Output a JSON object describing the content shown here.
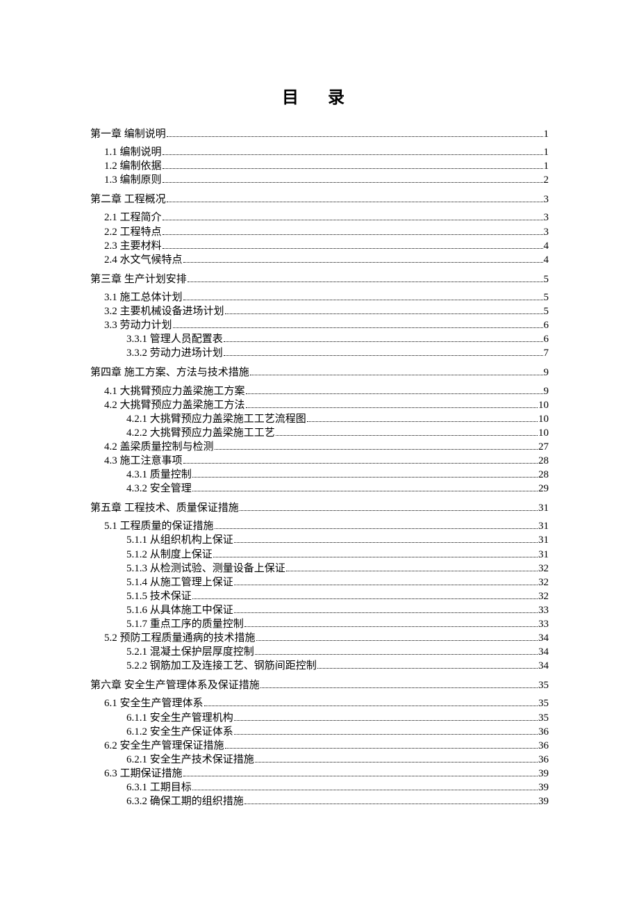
{
  "title": "目 录",
  "toc": [
    {
      "level": 1,
      "label": "第一章 编制说明",
      "page": "1"
    },
    {
      "level": 2,
      "label": "1.1 编制说明",
      "page": "1"
    },
    {
      "level": 2,
      "label": "1.2 编制依据",
      "page": "1"
    },
    {
      "level": 2,
      "label": "1.3 编制原则",
      "page": "2"
    },
    {
      "level": 1,
      "label": "第二章 工程概况",
      "page": "3"
    },
    {
      "level": 2,
      "label": "2.1 工程简介",
      "page": "3"
    },
    {
      "level": 2,
      "label": "2.2 工程特点",
      "page": "3"
    },
    {
      "level": 2,
      "label": "2.3 主要材料",
      "page": "4"
    },
    {
      "level": 2,
      "label": "2.4 水文气候特点",
      "page": "4"
    },
    {
      "level": 1,
      "label": "第三章   生产计划安排",
      "page": "5"
    },
    {
      "level": 2,
      "label": "3.1 施工总体计划",
      "page": "5"
    },
    {
      "level": 2,
      "label": "3.2 主要机械设备进场计划",
      "page": "5"
    },
    {
      "level": 2,
      "label": "3.3 劳动力计划",
      "page": "6"
    },
    {
      "level": 3,
      "label": "3.3.1 管理人员配置表",
      "page": "6"
    },
    {
      "level": 3,
      "label": "3.3.2 劳动力进场计划",
      "page": "7"
    },
    {
      "level": 1,
      "label": "第四章 施工方案、方法与技术措施",
      "page": "9"
    },
    {
      "level": 2,
      "label": "4.1 大挑臂预应力盖梁施工方案",
      "page": "9"
    },
    {
      "level": 2,
      "label": "4.2 大挑臂预应力盖梁施工方法",
      "page": "10"
    },
    {
      "level": 3,
      "label": "4.2.1 大挑臂预应力盖梁施工工艺流程图",
      "page": "10"
    },
    {
      "level": 3,
      "label": "4.2.2 大挑臂预应力盖梁施工工艺",
      "page": "10"
    },
    {
      "level": 2,
      "label": "4.2 盖梁质量控制与检测",
      "page": "27"
    },
    {
      "level": 2,
      "label": "4.3 施工注意事项",
      "page": "28"
    },
    {
      "level": 3,
      "label": "4.3.1 质量控制",
      "page": "28"
    },
    {
      "level": 3,
      "label": "4.3.2 安全管理",
      "page": "29"
    },
    {
      "level": 1,
      "label": "第五章 工程技术、质量保证措施",
      "page": "31"
    },
    {
      "level": 2,
      "label": "5.1 工程质量的保证措施",
      "page": "31"
    },
    {
      "level": 3,
      "label": "5.1.1 从组织机构上保证",
      "page": "31"
    },
    {
      "level": 3,
      "label": "5.1.2 从制度上保证",
      "page": "31"
    },
    {
      "level": 3,
      "label": "5.1.3 从检测试验、测量设备上保证",
      "page": "32"
    },
    {
      "level": 3,
      "label": "5.1.4 从施工管理上保证",
      "page": "32"
    },
    {
      "level": 3,
      "label": "5.1.5 技术保证",
      "page": "32"
    },
    {
      "level": 3,
      "label": "5.1.6 从具体施工中保证",
      "page": "33"
    },
    {
      "level": 3,
      "label": "5.1.7 重点工序的质量控制",
      "page": "33"
    },
    {
      "level": 2,
      "label": "5.2 预防工程质量通病的技术措施",
      "page": "34"
    },
    {
      "level": 3,
      "label": "5.2.1 混凝土保护层厚度控制",
      "page": "34"
    },
    {
      "level": 3,
      "label": "5.2.2 钢筋加工及连接工艺、钢筋间距控制",
      "page": "34"
    },
    {
      "level": 1,
      "label": "第六章 安全生产管理体系及保证措施",
      "page": "35"
    },
    {
      "level": 2,
      "label": "6.1 安全生产管理体系",
      "page": "35"
    },
    {
      "level": 3,
      "label": "6.1.1 安全生产管理机构",
      "page": "35"
    },
    {
      "level": 3,
      "label": "6.1.2 安全生产保证体系",
      "page": "36"
    },
    {
      "level": 2,
      "label": "6.2 安全生产管理保证措施",
      "page": "36"
    },
    {
      "level": 3,
      "label": "6.2.1 安全生产技术保证措施",
      "page": "36"
    },
    {
      "level": 2,
      "label": "6.3 工期保证措施",
      "page": "39"
    },
    {
      "level": 3,
      "label": "6.3.1 工期目标",
      "page": "39"
    },
    {
      "level": 3,
      "label": "6.3.2 确保工期的组织措施",
      "page": "39"
    }
  ]
}
